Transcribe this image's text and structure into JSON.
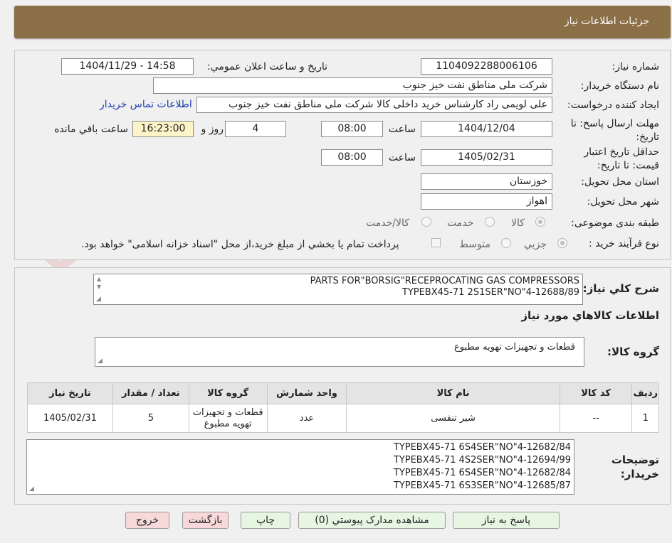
{
  "header": {
    "title": "جزئیات اطلاعات نیاز"
  },
  "form": {
    "need_number_label": "شماره نیاز:",
    "need_number": "1104092288006106",
    "announce_label": "تاریخ و ساعت اعلان عمومي:",
    "announce_value": "1404/11/29 - 14:58",
    "buyer_org_label": "نام دستگاه خريدار:",
    "buyer_org": "شرکت ملی مناطق نفت خیز جنوب",
    "requester_label": "ايجاد کننده درخواست:",
    "requester": "علی  لویمی راد  کارشناس خرید داخلی کالا شرکت ملی مناطق نفت خیز جنوب",
    "contact_link": "اطلاعات تماس خريدار",
    "deadline_label": "مهلت ارسال پاسخ: تا تاریخ:",
    "deadline_date": "1404/12/04",
    "time_label": "ساعت",
    "deadline_time": "08:00",
    "days_value": "4",
    "days_label": "روز و",
    "remaining_time": "16:23:00",
    "remaining_label": "ساعت باقي مانده",
    "validity_label": "حداقل تاريخ اعتبار قيمت: تا تاریخ:",
    "validity_date": "1405/02/31",
    "validity_time": "08:00",
    "province_label": "استان محل تحويل:",
    "province": "خوزستان",
    "city_label": "شهر محل تحويل:",
    "city": "اهواز",
    "category_label": "طبقه بندی موضوعی:",
    "category_options": [
      "کالا",
      "خدمت",
      "کالا/خدمت"
    ],
    "process_label": "نوع فرآيند خريد :",
    "process_options": [
      "جزيي",
      "متوسط"
    ],
    "process_note": "پرداخت تمام يا بخشي از مبلغ خريد،از محل \"اسناد خزانه اسلامی\" خواهد بود."
  },
  "description": {
    "label": "شرح کلي نياز:",
    "lines": [
      "PARTS FOR\"BORSIG\"RECEPROCATING GAS COMPRESSORS",
      "TYPEBX45-71 2S1SER\"NO\"4-12688/89"
    ]
  },
  "goods": {
    "section_title": "اطلاعات کالاهاي مورد نياز",
    "group_label": "گروه کالا:",
    "group_value": "قطعات و تجهیزات تهویه مطبوع",
    "table": {
      "headers": [
        "ردیف",
        "کد کالا",
        "نام کالا",
        "واحد شمارش",
        "گروه کالا",
        "تعداد / مقدار",
        "تاریخ نیاز"
      ],
      "rows": [
        [
          "1",
          "--",
          "شیر تنفسی",
          "عدد",
          "قطعات و تجهیزات تهویه مطبوع",
          "5",
          "1405/02/31"
        ]
      ]
    }
  },
  "buyer_notes": {
    "label": "توضيحات خريدار:",
    "lines": [
      "TYPEBX45-71 6S4SER\"NO\"4-12682/84",
      "TYPEBX45-71 4S2SER\"NO\"4-12694/99",
      "TYPEBX45-71 6S4SER\"NO\"4-12682/84",
      "TYPEBX45-71 6S3SER\"NO\"4-12685/87"
    ]
  },
  "buttons": {
    "respond": "پاسخ به نياز",
    "attachments": "مشاهده مدارک پيوستي (0)",
    "print": "چاپ",
    "back": "بازگشت",
    "exit": "خروج"
  },
  "colors": {
    "header": "#8b6f47",
    "link": "#1a3fb5",
    "remaining_bg": "#fdf5c8"
  },
  "watermark": {
    "text": "AriaTender.neT"
  }
}
